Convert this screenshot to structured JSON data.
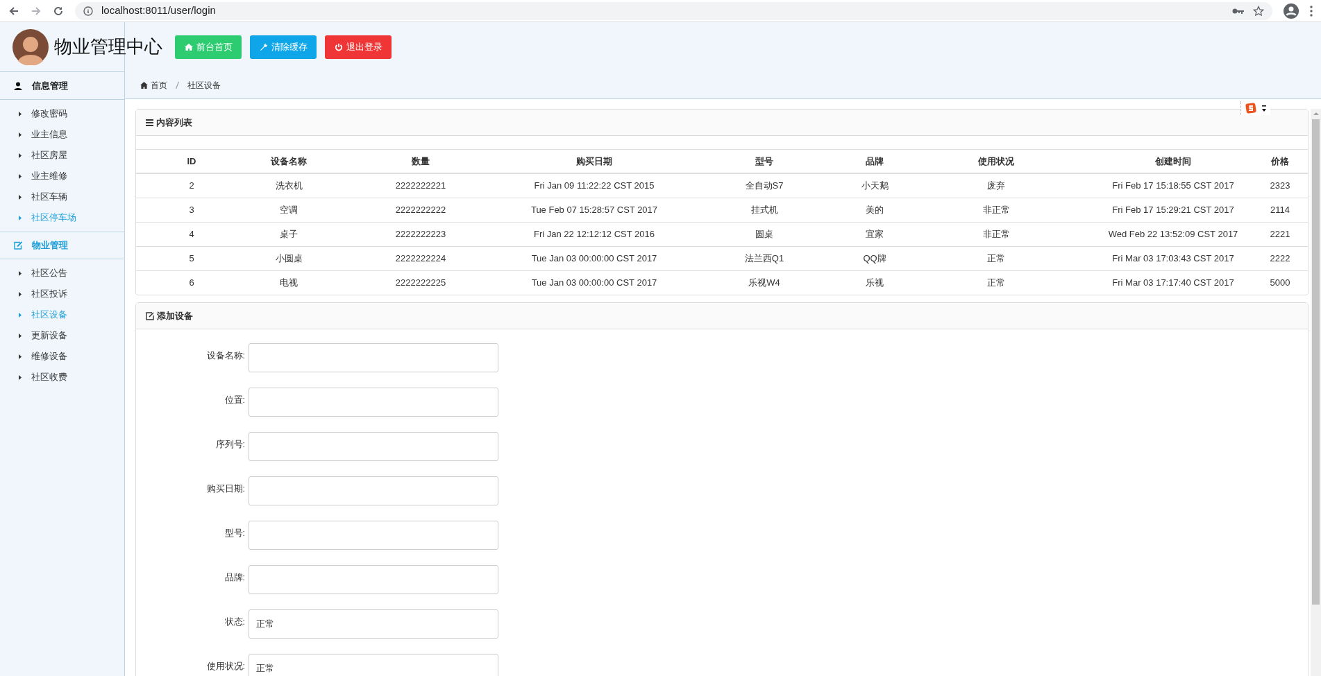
{
  "browser": {
    "url": "localhost:8011/user/login"
  },
  "header": {
    "title": "物业管理中心",
    "buttons": [
      {
        "label": "前台首页",
        "kind": "home",
        "color": "#2ecc71"
      },
      {
        "label": "清除缓存",
        "kind": "tool",
        "color": "#0ea5e9"
      },
      {
        "label": "退出登录",
        "kind": "logout",
        "color": "#ef3535"
      }
    ]
  },
  "sidebar": {
    "sections": [
      {
        "title": "信息管理",
        "kind": "user",
        "selected": false,
        "items": [
          {
            "label": "修改密码",
            "selected": false
          },
          {
            "label": "业主信息",
            "selected": false
          },
          {
            "label": "社区房屋",
            "selected": false
          },
          {
            "label": "业主维修",
            "selected": false
          },
          {
            "label": "社区车辆",
            "selected": false
          },
          {
            "label": "社区停车场",
            "selected": true
          }
        ]
      },
      {
        "title": "物业管理",
        "kind": "edit",
        "selected": true,
        "items": [
          {
            "label": "社区公告",
            "selected": false
          },
          {
            "label": "社区投诉",
            "selected": false
          },
          {
            "label": "社区设备",
            "selected": true
          },
          {
            "label": "更新设备",
            "selected": false
          },
          {
            "label": "维修设备",
            "selected": false
          },
          {
            "label": "社区收费",
            "selected": false
          }
        ]
      }
    ]
  },
  "breadcrumb": [
    "首页",
    "社区设备"
  ],
  "table": {
    "title": "内容列表",
    "columns": [
      "ID",
      "设备名称",
      "数量",
      "购买日期",
      "型号",
      "品牌",
      "使用状况",
      "创建时间",
      "价格"
    ],
    "rows": [
      [
        "2",
        "洗衣机",
        "2222222221",
        "Fri Jan 09 11:22:22 CST 2015",
        "全自动S7",
        "小天鹅",
        "废弃",
        "Fri Feb 17 15:18:55 CST 2017",
        "2323"
      ],
      [
        "3",
        "空调",
        "2222222222",
        "Tue Feb 07 15:28:57 CST 2017",
        "挂式机",
        "美的",
        "非正常",
        "Fri Feb 17 15:29:21 CST 2017",
        "2114"
      ],
      [
        "4",
        "桌子",
        "2222222223",
        "Fri Jan 22 12:12:12 CST 2016",
        "圆桌",
        "宜家",
        "非正常",
        "Wed Feb 22 13:52:09 CST 2017",
        "2221"
      ],
      [
        "5",
        "小圆桌",
        "2222222224",
        "Tue Jan 03 00:00:00 CST 2017",
        "法兰西Q1",
        "QQ牌",
        "正常",
        "Fri Mar 03 17:03:43 CST 2017",
        "2222"
      ],
      [
        "6",
        "电视",
        "2222222225",
        "Tue Jan 03 00:00:00 CST 2017",
        "乐视W4",
        "乐视",
        "正常",
        "Fri Mar 03 17:17:40 CST 2017",
        "5000"
      ]
    ]
  },
  "form": {
    "title": "添加设备",
    "fields": [
      {
        "label": "设备名称:"
      },
      {
        "label": "位置:"
      },
      {
        "label": "序列号:"
      },
      {
        "label": "购买日期:"
      },
      {
        "label": "型号:"
      },
      {
        "label": "品牌:"
      },
      {
        "label": "状态:",
        "value": "正常"
      },
      {
        "label": "使用状况:",
        "value": "正常"
      }
    ]
  }
}
